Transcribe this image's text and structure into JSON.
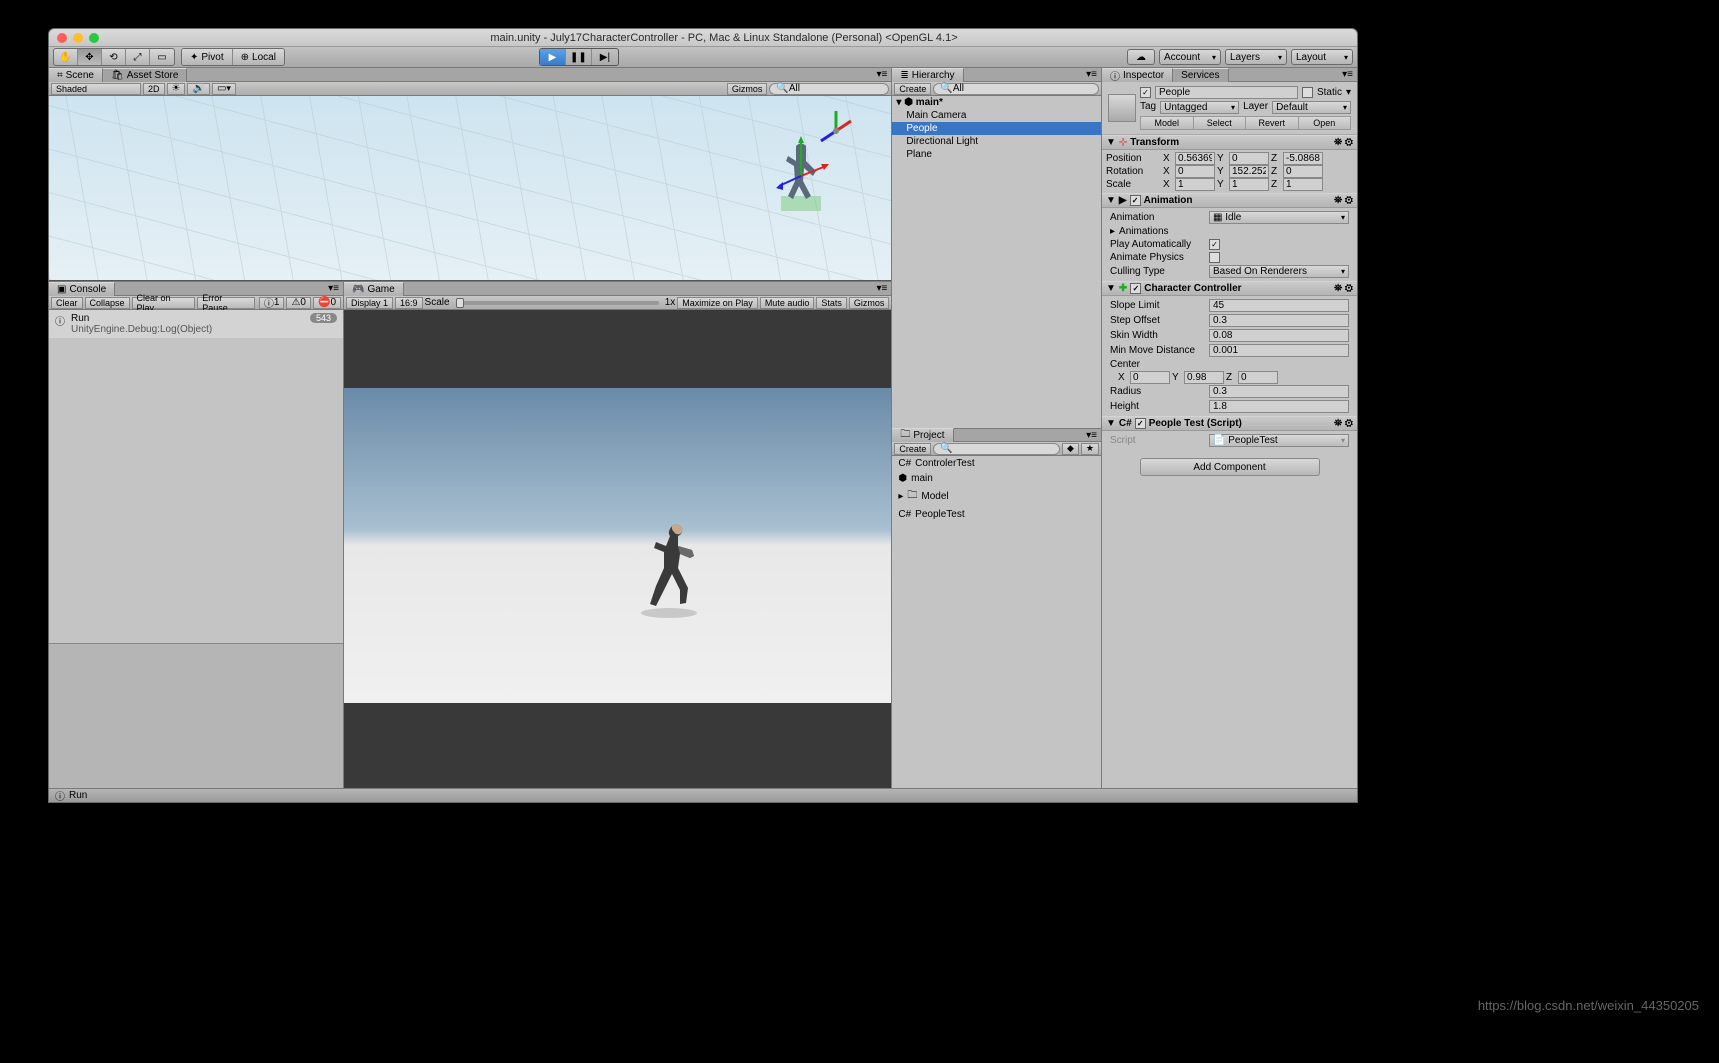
{
  "window": {
    "title": "main.unity - July17CharacterController - PC, Mac & Linux Standalone (Personal) <OpenGL 4.1>"
  },
  "toolbar": {
    "pivot": "Pivot",
    "local": "Local",
    "account": "Account",
    "layers": "Layers",
    "layout": "Layout"
  },
  "tabs": {
    "scene": "Scene",
    "assetstore": "Asset Store",
    "console": "Console",
    "game": "Game",
    "hierarchy": "Hierarchy",
    "project": "Project",
    "inspector": "Inspector",
    "services": "Services"
  },
  "scene": {
    "shaded": "Shaded",
    "mode2d": "2D",
    "gizmos": "Gizmos",
    "search_placeholder": "All"
  },
  "hierarchy": {
    "create": "Create",
    "search_placeholder": "All",
    "root": "main*",
    "items": [
      "Main Camera",
      "People",
      "Directional Light",
      "Plane"
    ]
  },
  "project": {
    "create": "Create",
    "items": [
      "ControlerTest",
      "main",
      "Model",
      "PeopleTest"
    ]
  },
  "console": {
    "buttons": {
      "clear": "Clear",
      "collapse": "Collapse",
      "clear_on_play": "Clear on Play",
      "error_pause": "Error Pause"
    },
    "counts": {
      "info": "1",
      "warn": "0",
      "error": "0"
    },
    "log": {
      "title": "Run",
      "detail": "UnityEngine.Debug:Log(Object)",
      "count": "543"
    }
  },
  "game": {
    "display": "Display 1",
    "aspect": "16:9",
    "scale": "Scale",
    "scale_val": "1x",
    "maximize": "Maximize on Play",
    "mute": "Mute audio",
    "stats": "Stats",
    "gizmos": "Gizmos"
  },
  "inspector": {
    "name": "People",
    "static": "Static",
    "tag_label": "Tag",
    "tag": "Untagged",
    "layer_label": "Layer",
    "layer": "Default",
    "model": "Model",
    "select": "Select",
    "revert": "Revert",
    "open": "Open",
    "transform": {
      "title": "Transform",
      "position": "Position",
      "pos": {
        "x": "0.56369",
        "y": "0",
        "z": "-5.0868"
      },
      "rotation": "Rotation",
      "rot": {
        "x": "0",
        "y": "152.252",
        "z": "0"
      },
      "scale": "Scale",
      "scl": {
        "x": "1",
        "y": "1",
        "z": "1"
      }
    },
    "animation": {
      "title": "Animation",
      "anim_label": "Animation",
      "anim_value": "Idle",
      "anims_label": "Animations",
      "play_auto": "Play Automatically",
      "anim_physics": "Animate Physics",
      "culling": "Culling Type",
      "culling_value": "Based On Renderers"
    },
    "cc": {
      "title": "Character Controller",
      "slope": "Slope Limit",
      "slope_v": "45",
      "step": "Step Offset",
      "step_v": "0.3",
      "skin": "Skin Width",
      "skin_v": "0.08",
      "minmove": "Min Move Distance",
      "minmove_v": "0.001",
      "center": "Center",
      "cx": "0",
      "cy": "0.98",
      "cz": "0",
      "radius": "Radius",
      "radius_v": "0.3",
      "height": "Height",
      "height_v": "1.8"
    },
    "script": {
      "title": "People Test (Script)",
      "label": "Script",
      "value": "PeopleTest"
    },
    "add_component": "Add Component"
  },
  "status": {
    "msg": "Run"
  },
  "watermark": "https://blog.csdn.net/weixin_44350205"
}
